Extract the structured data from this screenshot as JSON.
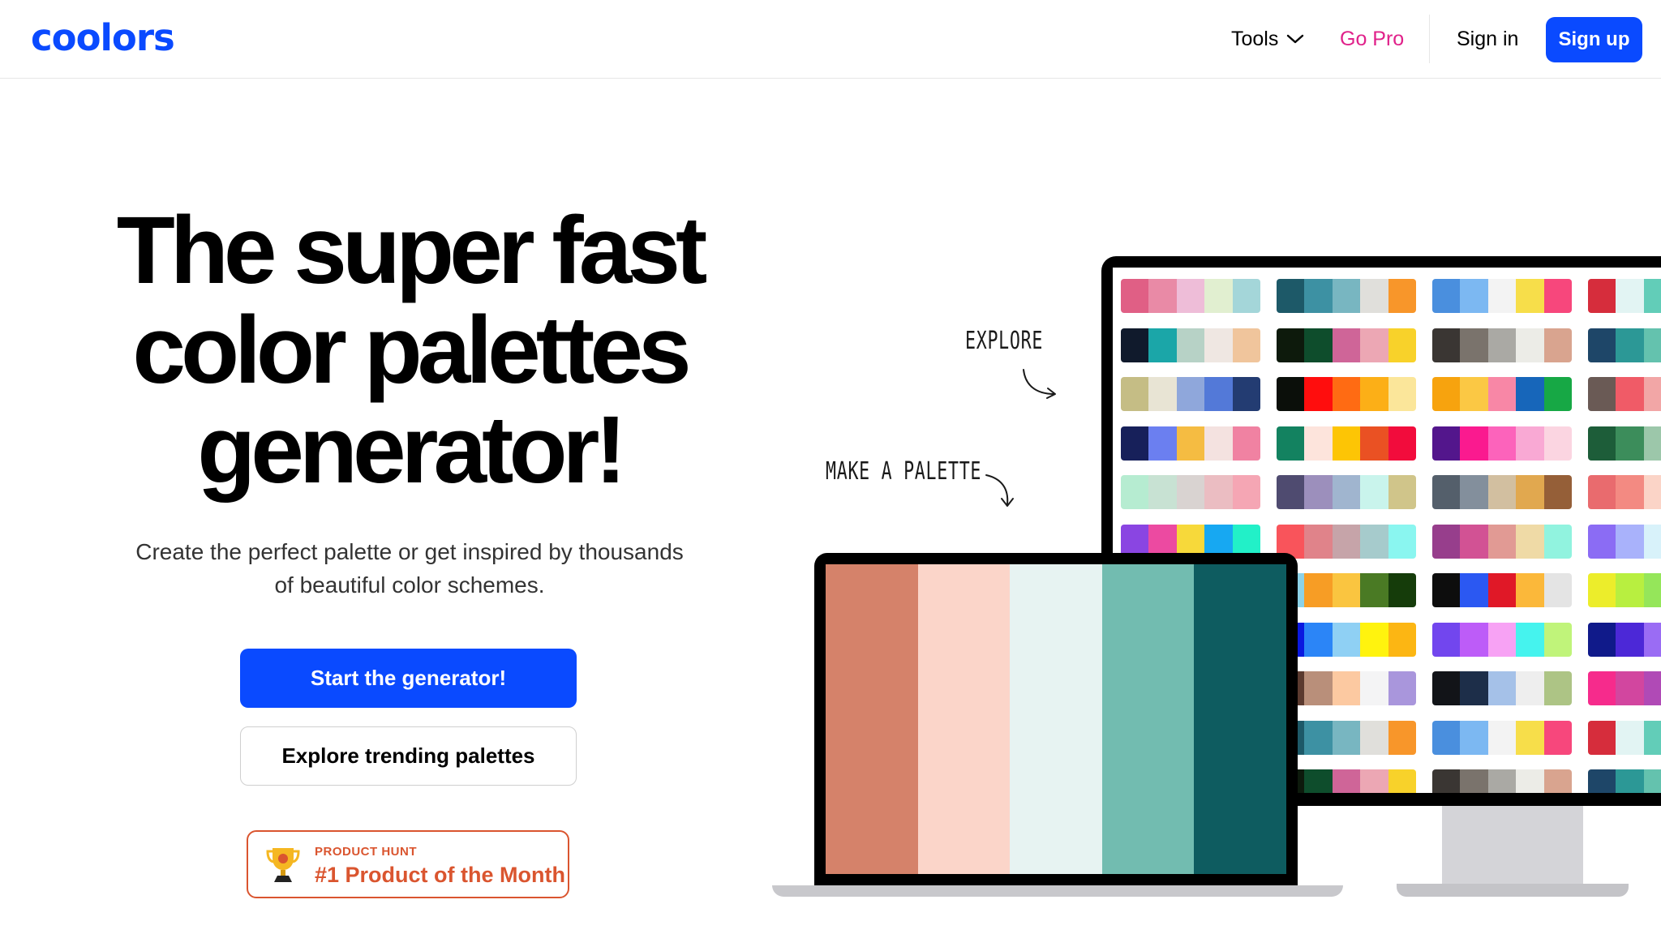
{
  "header": {
    "logo_text": "coolors",
    "nav": {
      "tools_label": "Tools",
      "gopro_label": "Go Pro",
      "signin_label": "Sign in",
      "signup_label": "Sign up"
    }
  },
  "hero": {
    "title_lines": [
      "The super fast",
      "color palettes",
      "generator!"
    ],
    "subtitle": "Create the perfect palette or get inspired by thousands of beautiful color schemes.",
    "primary_button": "Start the generator!",
    "secondary_button": "Explore trending palettes",
    "badge": {
      "small_text": "PRODUCT HUNT",
      "main_text": "#1 Product of the Month"
    }
  },
  "illustration": {
    "annotation_explore": "EXPLORE",
    "annotation_make": "MAKE A PALETTE",
    "laptop_palette": [
      "#d5826a",
      "#fbd5c9",
      "#e7f3f2",
      "#72bcb0",
      "#0e5c60"
    ],
    "monitor_palettes": [
      [
        "#e05f85",
        "#e98aa6",
        "#eebdd8",
        "#e1efd0",
        "#a4d6d9"
      ],
      [
        "#1d5968",
        "#3d91a3",
        "#78b6c1",
        "#e0dfdb",
        "#f8962a"
      ],
      [
        "#4a8fde",
        "#7cb8f2",
        "#f3f3f3",
        "#f7de4a",
        "#f7477c"
      ],
      [
        "#d62d3c",
        "#e2f4f3",
        "#62cdb8",
        "#f4f4f4",
        "#f2f2f2"
      ],
      [
        "#101a2c",
        "#1ba6a8",
        "#b7d2c6",
        "#efe7e2",
        "#f0c59c"
      ],
      [
        "#0d1a0c",
        "#0e4d2c",
        "#cf6598",
        "#eca7b4",
        "#f8d22a"
      ],
      [
        "#3a3633",
        "#7a736c",
        "#aaa9a4",
        "#ecece7",
        "#d9a48f"
      ],
      [
        "#1e4668",
        "#2c9896",
        "#64c2ae",
        "#f3f3f3",
        "#f2f2f2"
      ],
      [
        "#c5bd85",
        "#e8e4d4",
        "#8fa7db",
        "#5379d8",
        "#233c72"
      ],
      [
        "#0b0f0a",
        "#ff0d0d",
        "#ff6b13",
        "#fcaf17",
        "#fbe69a"
      ],
      [
        "#f7a30e",
        "#fbc844",
        "#f887a6",
        "#1766ba",
        "#17a845"
      ],
      [
        "#6a5a55",
        "#f05b67",
        "#f2a6a6",
        "#f4f4f4",
        "#f2f2f2"
      ],
      [
        "#17205a",
        "#6b7ff0",
        "#f5bc42",
        "#f4e2e0",
        "#f082a2"
      ],
      [
        "#138260",
        "#fde4dc",
        "#fdc505",
        "#ea5123",
        "#f20c3c"
      ],
      [
        "#53168c",
        "#fa1a8f",
        "#fc63bb",
        "#f9a9d4",
        "#fbd5e1"
      ],
      [
        "#1d5d39",
        "#3c8d5b",
        "#9cc7aa",
        "#f4f4f4",
        "#f2f2f2"
      ],
      [
        "#b6ecd1",
        "#c8e2d3",
        "#d9d3d1",
        "#ebbdc2",
        "#f5a6b4"
      ],
      [
        "#4f4b70",
        "#9c8fbc",
        "#a0b5cf",
        "#c9f4ec",
        "#d0c58a"
      ],
      [
        "#545f6b",
        "#838f9c",
        "#d2bfa0",
        "#e1a84f",
        "#955f38"
      ],
      [
        "#e96b6e",
        "#f38a82",
        "#fbd4c7",
        "#f4f4f4",
        "#f2f2f2"
      ],
      [
        "#8a45e2",
        "#ec4aa1",
        "#f7d93a",
        "#17a8f2",
        "#22f0c8"
      ],
      [
        "#f9545b",
        "#e0838a",
        "#c6a4a9",
        "#a6cbcc",
        "#8af6f0"
      ],
      [
        "#973e8c",
        "#d25294",
        "#e19a94",
        "#efdaa6",
        "#91f3df"
      ],
      [
        "#8b6cf4",
        "#a9b2fb",
        "#d8f2fa",
        "#f4f4f4",
        "#f2f2f2"
      ],
      [
        "#0b9ef1",
        "#fbbc2b",
        "#f9a315",
        "#fdc63f",
        "#46761d"
      ],
      [
        "#8cd2e8",
        "#f79d25",
        "#fac540",
        "#4a7a24",
        "#153c0a"
      ],
      [
        "#0d0d0d",
        "#2b58f2",
        "#e01827",
        "#fbb83a",
        "#e4e4e4"
      ],
      [
        "#eced2b",
        "#b8ef40",
        "#95e65a",
        "#f4f4f4",
        "#f2f2f2"
      ],
      [
        "#1210cc",
        "#1222ef",
        "#2d8cf7",
        "#8fd1f4",
        "#fff60a"
      ],
      [
        "#0a19e0",
        "#2b85f7",
        "#8fd0f4",
        "#fff30e",
        "#fcb613"
      ],
      [
        "#7246ee",
        "#bd5cf8",
        "#f7a2f4",
        "#45f3ee",
        "#c0f47a"
      ],
      [
        "#101a8a",
        "#4c28d7",
        "#9a6cf4",
        "#f4f4f4",
        "#f2f2f2"
      ],
      [
        "#2c1b1a",
        "#5b3a2f",
        "#b98f7a",
        "#fcc9a1",
        "#f4f4f5"
      ],
      [
        "#5b3a2f",
        "#b98f7a",
        "#fcc9a1",
        "#f4f4f5",
        "#a996dc"
      ],
      [
        "#121418",
        "#1d2e49",
        "#a5c1e8",
        "#eeeeee",
        "#adc485"
      ],
      [
        "#f62b8c",
        "#d2469f",
        "#b04ab6",
        "#f4f4f4",
        "#f2f2f2"
      ],
      [
        "#1d5968",
        "#3d91a3",
        "#78b6c1",
        "#e0dfdb",
        "#f8962a"
      ],
      [
        "#1d5968",
        "#3d91a3",
        "#78b6c1",
        "#e0dfdb",
        "#f8962a"
      ],
      [
        "#4a8fde",
        "#7cb8f2",
        "#f3f3f3",
        "#f7de4a",
        "#f7477c"
      ],
      [
        "#d62d3c",
        "#e2f4f3",
        "#62cdb8",
        "#f4f4f4",
        "#f2f2f2"
      ],
      [
        "#101a2c",
        "#1ba6a8",
        "#b7d2c6",
        "#efe7e2",
        "#f0c59c"
      ],
      [
        "#0d1a0c",
        "#0e4d2c",
        "#cf6598",
        "#eca7b4",
        "#f8d22a"
      ],
      [
        "#3a3633",
        "#7a736c",
        "#aaa9a4",
        "#ecece7",
        "#d9a48f"
      ],
      [
        "#1e4668",
        "#2c9896",
        "#64c2ae",
        "#f3f3f3",
        "#f2f2f2"
      ]
    ]
  },
  "colors": {
    "brand_blue": "#0a4aff",
    "gopro_pink": "#e0218a",
    "producthunt_orange": "#da552f"
  }
}
